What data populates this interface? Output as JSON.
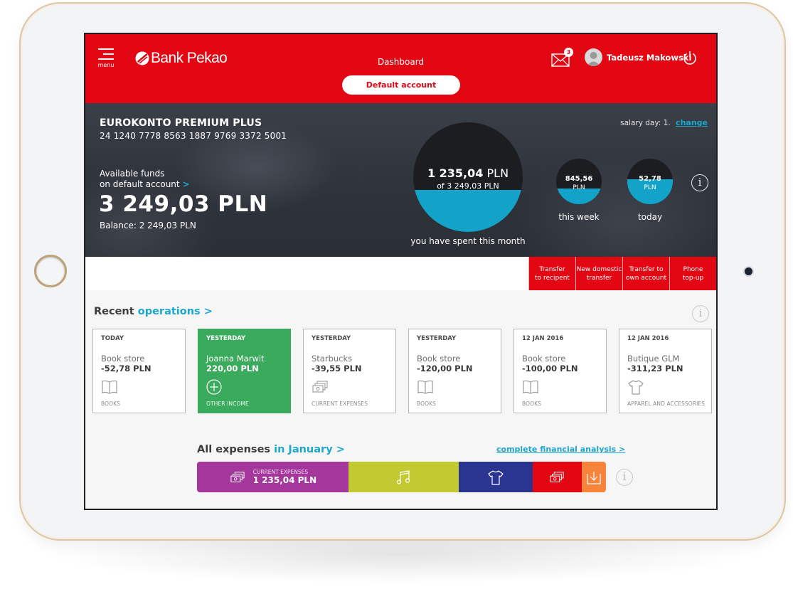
{
  "header": {
    "menu_label": "menu",
    "brand": "Bank Pekao",
    "page_title": "Dashboard",
    "account_switch_label": "Default account",
    "messages_count": "3",
    "user_name": "Tadeusz Makowski"
  },
  "account": {
    "name": "EUROKONTO PREMIUM PLUS",
    "number": "24 1240 7778 8563 1887 9769 3372 5001",
    "funds_label_line1": "Available funds",
    "funds_label_line2": "on default account",
    "funds_link_glyph": ">",
    "available_funds": "3 249,03 PLN",
    "balance": "Balance: 2 249,03 PLN",
    "salary_label": "salary day: 1.",
    "salary_change": "change"
  },
  "spending": {
    "month": {
      "amount": "1 235,04",
      "currency": "PLN",
      "of_total": "of 3 249,03 PLN",
      "caption": "you have spent this month",
      "fill_fraction": 0.38
    },
    "week": {
      "amount": "845,56",
      "currency": "PLN",
      "caption": "this week",
      "fill_fraction": 0.35
    },
    "today": {
      "amount": "52,78",
      "currency": "PLN",
      "caption": "today",
      "fill_fraction": 0.55
    },
    "info_glyph": "i"
  },
  "quick_actions": [
    {
      "line1": "Transfer",
      "line2": "to recipent"
    },
    {
      "line1": "New domestic",
      "line2": "transfer"
    },
    {
      "line1": "Transfer to",
      "line2": "own account"
    },
    {
      "line1": "Phone",
      "line2": "top-up"
    }
  ],
  "recent": {
    "title": "Recent",
    "title_accent": "operations >",
    "info_glyph": "i",
    "operations": [
      {
        "date": "TODAY",
        "name": "Book store",
        "amount": "-52,78 PLN",
        "icon": "book-icon",
        "category": "BOOKS"
      },
      {
        "date": "YESTERDAY",
        "name": "Joanna Marwit",
        "amount": "220,00 PLN",
        "icon": "plus-circle-icon",
        "category": "OTHER INCOME"
      },
      {
        "date": "YESTERDAY",
        "name": "Starbucks",
        "amount": "-39,55 PLN",
        "icon": "banknotes-icon",
        "category": "CURRENT EXPENSES"
      },
      {
        "date": "YESTERDAY",
        "name": "Book store",
        "amount": "-120,00 PLN",
        "icon": "book-icon",
        "category": "BOOKS"
      },
      {
        "date": "12 JAN 2016",
        "name": "Book store",
        "amount": "-100,00 PLN",
        "icon": "book-icon",
        "category": "BOOKS"
      },
      {
        "date": "12 JAN 2016",
        "name": "Butique GLM",
        "amount": "-311,23 PLN",
        "icon": "tshirt-icon",
        "category": "APPAREL AND ACCESSORIES"
      }
    ]
  },
  "expenses": {
    "title": "All expenses",
    "title_accent": "in January >",
    "analysis_link": "complete financial analysis >",
    "info_glyph": "i",
    "segments": [
      {
        "category": "current-expenses",
        "label": "CURRENT EXPENSES",
        "value": "1 235,04 PLN",
        "icon": "banknotes-icon",
        "color": "#a4369c",
        "share": 0.37
      },
      {
        "category": "entertainment",
        "icon": "music-note-icon",
        "color": "#c3c930",
        "share": 0.27
      },
      {
        "category": "apparel",
        "icon": "tshirt-icon",
        "color": "#2a3592",
        "share": 0.18
      },
      {
        "category": "other-expenses",
        "icon": "banknotes-icon",
        "color": "#e30613",
        "share": 0.12
      },
      {
        "category": "savings",
        "icon": "download-tray-icon",
        "color": "#f7843a",
        "share": 0.06
      }
    ]
  },
  "colors": {
    "brand_red": "#e30613",
    "accent_blue": "#1ca7cc",
    "income_green": "#3aaa5c",
    "gauge_dark": "#1c1d20"
  }
}
